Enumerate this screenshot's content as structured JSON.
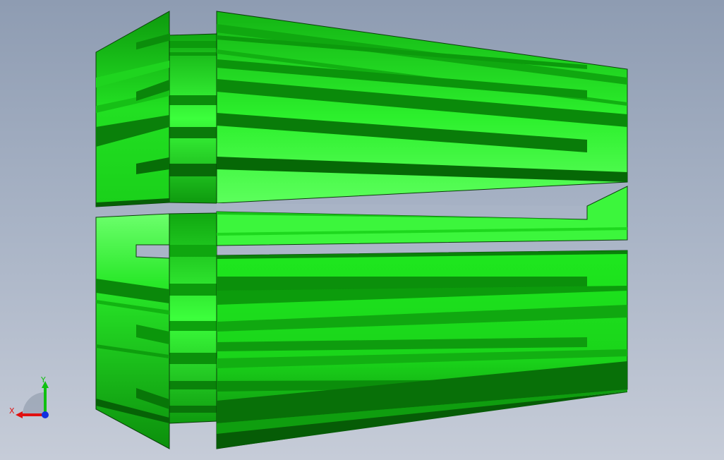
{
  "viewport": {
    "background_top": "#8e9cb2",
    "background_bottom": "#c6ccd8"
  },
  "model": {
    "colors": {
      "face_bright": "#55ff55",
      "face_main": "#1fe21f",
      "face_mid": "#12c012",
      "face_dark": "#0a8a0a",
      "face_deep": "#065f06",
      "edge": "#0a3d0a"
    }
  },
  "triad": {
    "x_label": "X",
    "y_label": "Y",
    "x_color": "#e01010",
    "y_color": "#10c010",
    "z_color": "#1030e0"
  }
}
